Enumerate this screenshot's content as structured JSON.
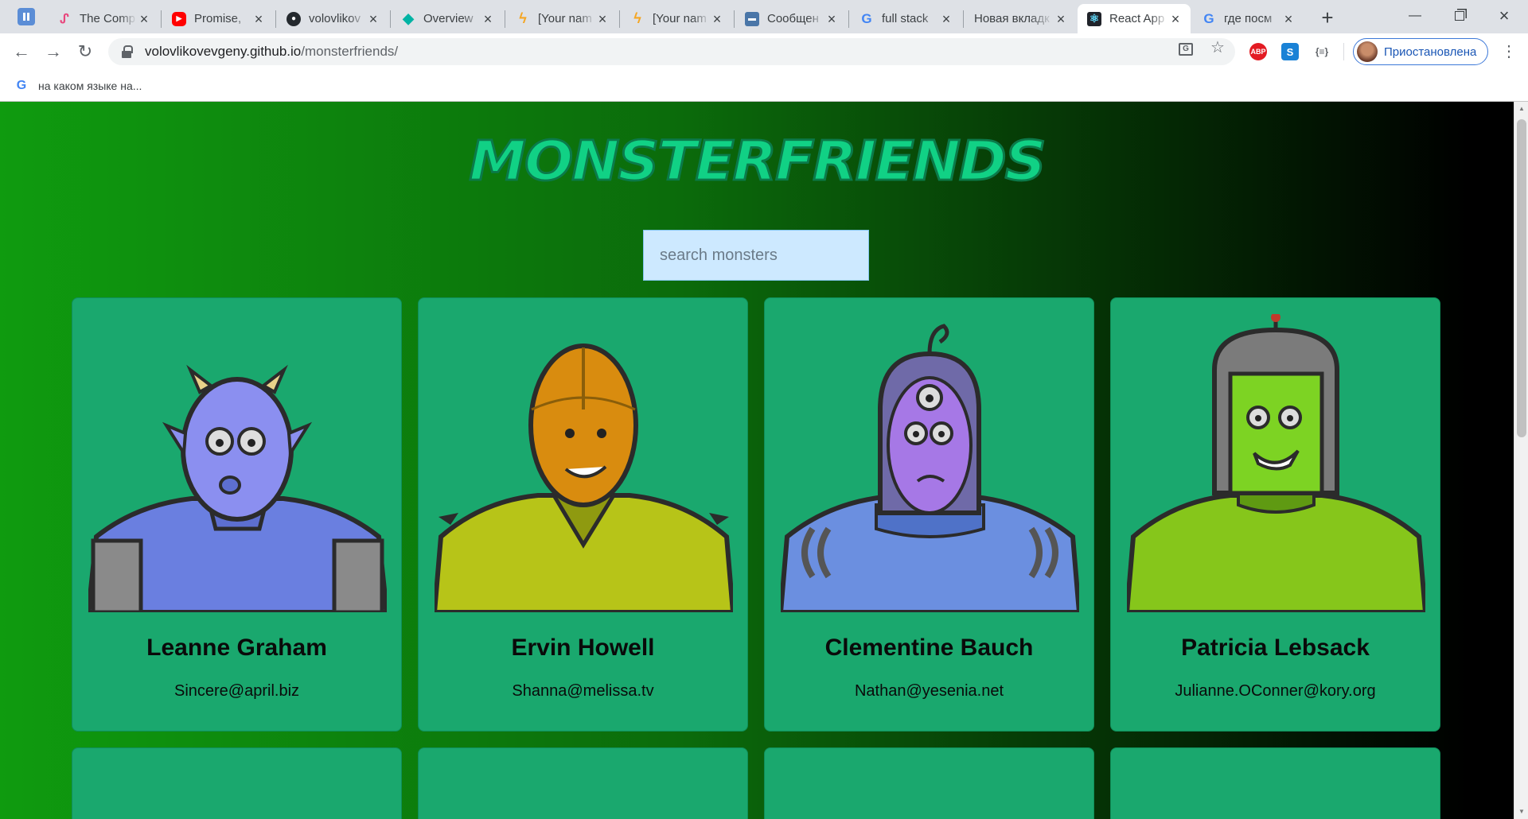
{
  "browser": {
    "tabs": [
      {
        "title": "The Comp",
        "favicon": "scribble-icon",
        "color": "#e8467c"
      },
      {
        "title": "Promise, ",
        "favicon": "youtube-icon",
        "color": "#ff0000"
      },
      {
        "title": "volovlikov",
        "favicon": "github-icon",
        "color": "#24292e"
      },
      {
        "title": "Overview",
        "favicon": "diamond-icon",
        "color": "#00b3a4"
      },
      {
        "title": "[Your nam",
        "favicon": "bolt-icon",
        "color": "#f5a623"
      },
      {
        "title": "[Your nam",
        "favicon": "bolt-icon",
        "color": "#f5a623"
      },
      {
        "title": "Сообщен",
        "favicon": "chat-icon",
        "color": "#4a76a8"
      },
      {
        "title": "full stack",
        "favicon": "google-icon",
        "color": "#4285f4"
      },
      {
        "title": "Новая вкладк",
        "favicon": "",
        "color": ""
      },
      {
        "title": "React App",
        "favicon": "react-icon",
        "color": "#61dafb",
        "active": true
      },
      {
        "title": "где посм",
        "favicon": "google-icon",
        "color": "#4285f4"
      }
    ],
    "url_host": "volovlikovevgeny.github.io",
    "url_path": "/monsterfriends/",
    "profile_label": "Приостановлена",
    "bookmark": "на каком языке на..."
  },
  "page": {
    "title": "MONSTERFRIENDS",
    "search_placeholder": "search monsters",
    "monsters": [
      {
        "name": "Leanne Graham",
        "email": "Sincere@april.biz",
        "skin": "#8b8ff0",
        "shirt": "#6a7fe0"
      },
      {
        "name": "Ervin Howell",
        "email": "Shanna@melissa.tv",
        "skin": "#d98c0f",
        "shirt": "#b7c418"
      },
      {
        "name": "Clementine Bauch",
        "email": "Nathan@yesenia.net",
        "skin": "#a678e6",
        "shirt": "#6b8fe0"
      },
      {
        "name": "Patricia Lebsack",
        "email": "Julianne.OConner@kory.org",
        "skin": "#7dd323",
        "shirt": "#86c61b"
      }
    ]
  }
}
